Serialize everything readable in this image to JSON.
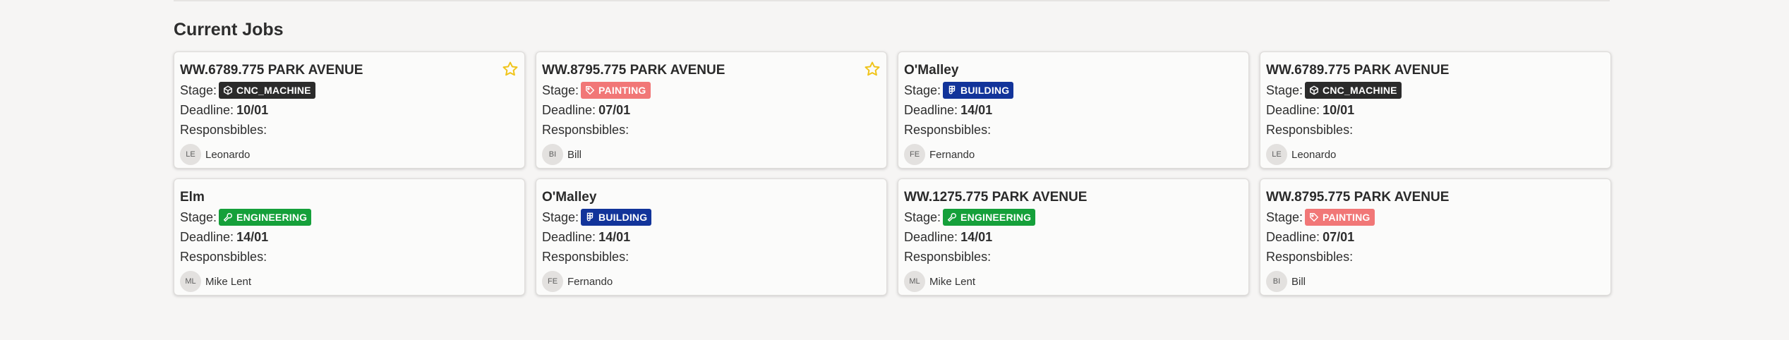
{
  "section_title": "Current Jobs",
  "labels": {
    "stage": "Stage:",
    "deadline": "Deadline:",
    "responsibles": "Responsbibles:"
  },
  "stage_colors": {
    "CNC_MACHINE": "#2b2b2b",
    "PAINTING": "#f17777",
    "BUILDING": "#12349a",
    "ENGINEERING": "#15a03a"
  },
  "star_color": "#f0c419",
  "jobs": [
    {
      "title": "WW.6789.775 PARK AVENUE",
      "stage": "CNC_MACHINE",
      "stage_icon": "cube-icon",
      "deadline": "10/01",
      "responsible": {
        "initials": "LE",
        "name": "Leonardo"
      },
      "starred": true
    },
    {
      "title": "WW.8795.775 PARK AVENUE",
      "stage": "PAINTING",
      "stage_icon": "tag-icon",
      "deadline": "07/01",
      "responsible": {
        "initials": "BI",
        "name": "Bill"
      },
      "starred": true
    },
    {
      "title": "O'Malley",
      "stage": "BUILDING",
      "stage_icon": "figma-icon",
      "deadline": "14/01",
      "responsible": {
        "initials": "FE",
        "name": "Fernando"
      },
      "starred": false
    },
    {
      "title": "WW.6789.775 PARK AVENUE",
      "stage": "CNC_MACHINE",
      "stage_icon": "cube-icon",
      "deadline": "10/01",
      "responsible": {
        "initials": "LE",
        "name": "Leonardo"
      },
      "starred": false
    },
    {
      "title": "Elm",
      "stage": "ENGINEERING",
      "stage_icon": "wrench-icon",
      "deadline": "14/01",
      "responsible": {
        "initials": "ML",
        "name": "Mike Lent"
      },
      "starred": false
    },
    {
      "title": "O'Malley",
      "stage": "BUILDING",
      "stage_icon": "figma-icon",
      "deadline": "14/01",
      "responsible": {
        "initials": "FE",
        "name": "Fernando"
      },
      "starred": false
    },
    {
      "title": "WW.1275.775 PARK AVENUE",
      "stage": "ENGINEERING",
      "stage_icon": "wrench-icon",
      "deadline": "14/01",
      "responsible": {
        "initials": "ML",
        "name": "Mike Lent"
      },
      "starred": false
    },
    {
      "title": "WW.8795.775 PARK AVENUE",
      "stage": "PAINTING",
      "stage_icon": "tag-icon",
      "deadline": "07/01",
      "responsible": {
        "initials": "BI",
        "name": "Bill"
      },
      "starred": false
    }
  ]
}
